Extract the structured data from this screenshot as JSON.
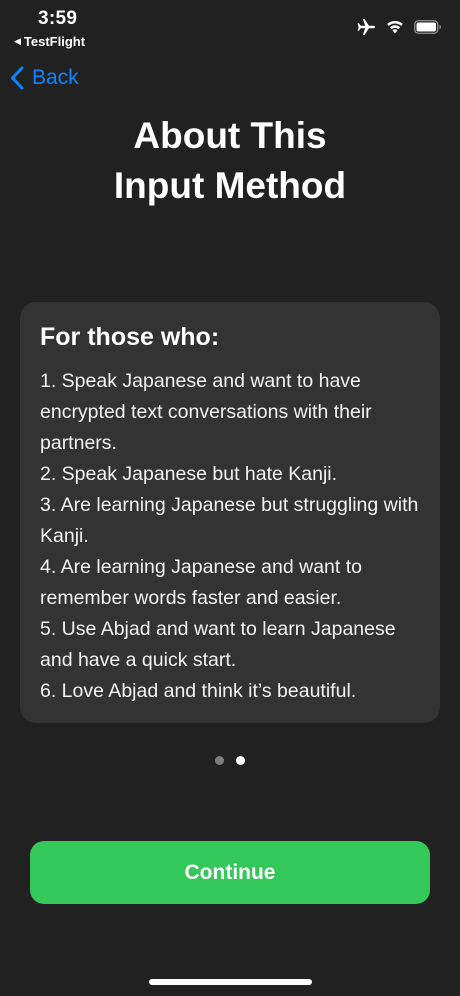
{
  "status_bar": {
    "time": "3:59",
    "back_app": "TestFlight",
    "icons": [
      "airplane-mode-icon",
      "wifi-icon",
      "battery-icon"
    ]
  },
  "nav": {
    "back_label": "Back"
  },
  "page": {
    "title_line1": "About This",
    "title_line2": "Input Method"
  },
  "card": {
    "heading": "For those who:",
    "items": [
      "1. Speak Japanese and want to have encrypted text conversations with their partners.",
      "2. Speak Japanese but hate Kanji.",
      "3. Are learning Japanese but struggling with Kanji.",
      "4. Are learning Japanese and want to remember words faster and easier.",
      "5. Use Abjad and want to learn Japanese and have a quick start.",
      "6. Love Abjad and think it’s beautiful."
    ]
  },
  "pager": {
    "total": 2,
    "current": 2
  },
  "actions": {
    "continue_label": "Continue"
  },
  "colors": {
    "background": "#212121",
    "card": "#333333",
    "accent_blue": "#0a84ff",
    "button_green": "#34c759"
  }
}
